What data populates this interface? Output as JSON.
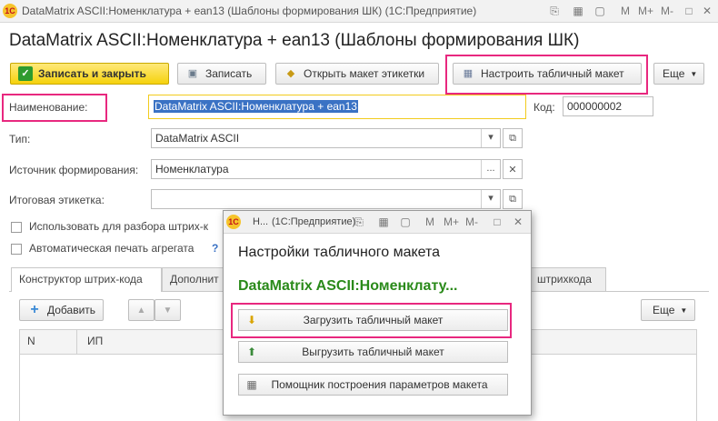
{
  "window": {
    "title": "DataMatrix ASCII:Номенклатура + ean13 (Шаблоны формирования ШК)  (1С:Предприятие)",
    "logo": "1С"
  },
  "page": {
    "title": "DataMatrix ASCII:Номенклатура + ean13 (Шаблоны формирования ШК)"
  },
  "toolbar": {
    "save_close": "Записать и закрыть",
    "save": "Записать",
    "open_label": "Открыть макет этикетки",
    "configure_table": "Настроить табличный макет",
    "more": "Еще"
  },
  "form": {
    "name_label": "Наименование:",
    "name_value": "DataMatrix ASCII:Номенклатура + ean13",
    "code_label": "Код:",
    "code_value": "000000002",
    "type_label": "Тип:",
    "type_value": "DataMatrix ASCII",
    "source_label": "Источник формирования:",
    "source_value": "Номенклатура",
    "final_label_label": "Итоговая этикетка:",
    "final_label_value": "",
    "checkbox_parse": "Использовать для разбора штрих-к",
    "checkbox_autoprint": "Автоматическая печать агрегата",
    "help": "?"
  },
  "tabs": [
    {
      "label": "Конструктор штрих-кода"
    },
    {
      "label": "Дополнит"
    },
    {
      "label": "штрихкода"
    }
  ],
  "table_toolbar": {
    "add": "Добавить",
    "more": "Еще"
  },
  "table": {
    "columns": [
      "N",
      "ИП"
    ]
  },
  "modal": {
    "title_prefix": "Н...",
    "title_app": "(1С:Предприятие)",
    "heading": "Настройки табличного макета",
    "template_name": "DataMatrix ASCII:Номенклату...",
    "buttons": {
      "load": "Загрузить табличный макет",
      "export": "Выгрузить табличный макет",
      "assistant": "Помощник построения параметров макета"
    }
  },
  "colors": {
    "highlight": "#e8287f",
    "primary": "#f5d20d",
    "selection": "#3a72c4",
    "green_title": "#2a8a1a"
  }
}
